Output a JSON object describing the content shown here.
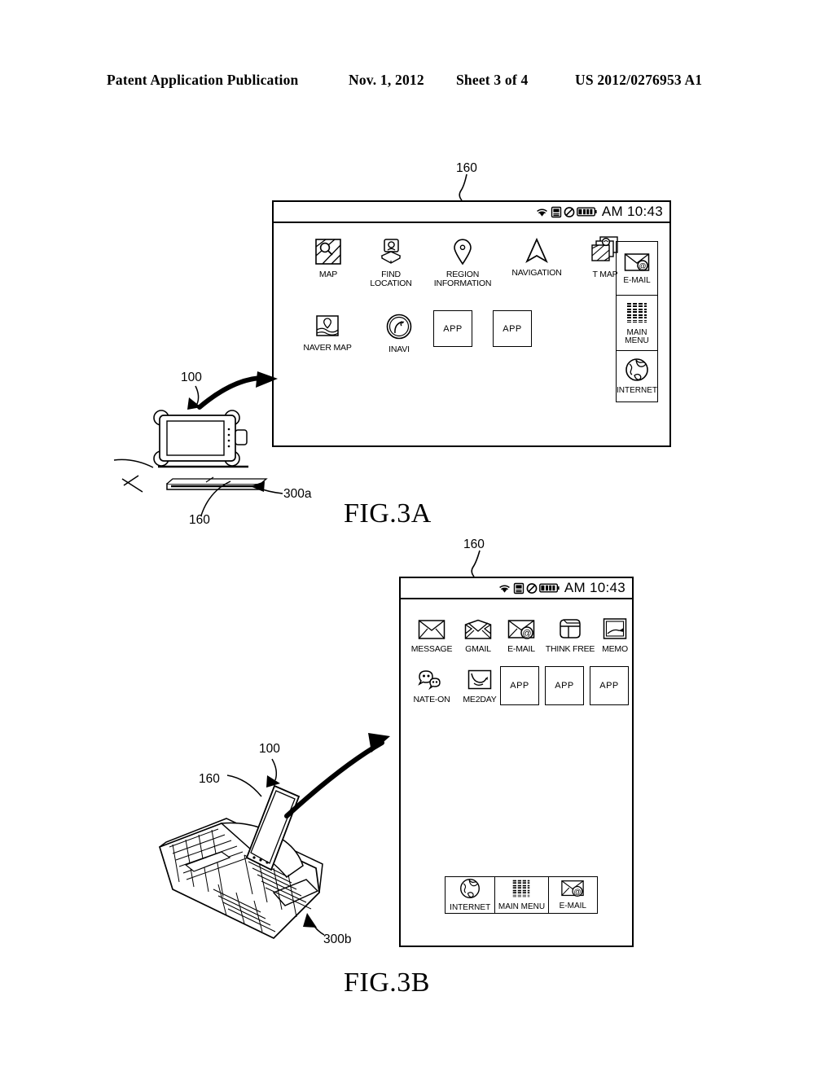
{
  "header": {
    "publication": "Patent Application Publication",
    "date": "Nov. 1, 2012",
    "sheet": "Sheet 3 of 4",
    "number": "US 2012/0276953 A1"
  },
  "figures": [
    {
      "caption": "FIG.3A",
      "screen": {
        "status_bar": {
          "time": "AM 10:43",
          "icons": [
            "wifi-icon",
            "sd-card-icon",
            "mute-icon",
            "battery-icon"
          ]
        },
        "apps_row1": [
          {
            "label": "MAP",
            "icon": "map-icon"
          },
          {
            "label": "FIND\nLOCATION",
            "icon": "find-location-icon"
          },
          {
            "label": "REGION\nINFORMATION",
            "icon": "map-pin-icon"
          },
          {
            "label": "NAVIGATION",
            "icon": "navigation-arrow-icon"
          },
          {
            "label": "T MAP",
            "icon": "t-map-icon"
          }
        ],
        "apps_row2": [
          {
            "label": "NAVER MAP",
            "icon": "naver-map-icon"
          },
          {
            "label": "INAVI",
            "icon": "inavi-icon"
          }
        ],
        "app_placeholders": [
          "APP",
          "APP"
        ],
        "side_dock": [
          {
            "label": "E-MAIL",
            "icon": "email-icon"
          },
          {
            "label": "MAIN\nMENU",
            "icon": "grid-menu-icon"
          },
          {
            "label": "INTERNET",
            "icon": "globe-icon"
          }
        ]
      },
      "ref_numerals": [
        {
          "value": "160",
          "target": "screen-display"
        },
        {
          "value": "100",
          "target": "portable-device"
        },
        {
          "value": "160",
          "target": "device-display"
        },
        {
          "value": "300a",
          "target": "car-dock-cradle"
        }
      ]
    },
    {
      "caption": "FIG.3B",
      "screen": {
        "status_bar": {
          "time": "AM 10:43",
          "icons": [
            "wifi-icon",
            "sd-card-icon",
            "mute-icon",
            "battery-icon"
          ]
        },
        "apps_row1": [
          {
            "label": "MESSAGE",
            "icon": "envelope-icon"
          },
          {
            "label": "GMAIL",
            "icon": "gmail-icon"
          },
          {
            "label": "E-MAIL",
            "icon": "email-at-icon"
          },
          {
            "label": "THINK FREE",
            "icon": "think-free-icon"
          },
          {
            "label": "MEMO",
            "icon": "memo-icon"
          }
        ],
        "apps_row2": [
          {
            "label": "NATE-ON",
            "icon": "nate-on-icon"
          },
          {
            "label": "ME2DAY",
            "icon": "me2day-icon"
          }
        ],
        "app_placeholders": [
          "APP",
          "APP",
          "APP"
        ],
        "bottom_dock": [
          {
            "label": "INTERNET",
            "icon": "globe-icon"
          },
          {
            "label": "MAIN MENU",
            "icon": "grid-menu-icon"
          },
          {
            "label": "E-MAIL",
            "icon": "email-at-icon"
          }
        ]
      },
      "ref_numerals": [
        {
          "value": "160",
          "target": "screen-display"
        },
        {
          "value": "100",
          "target": "portable-device"
        },
        {
          "value": "160",
          "target": "device-display"
        },
        {
          "value": "300b",
          "target": "keyboard-dock"
        }
      ]
    }
  ]
}
